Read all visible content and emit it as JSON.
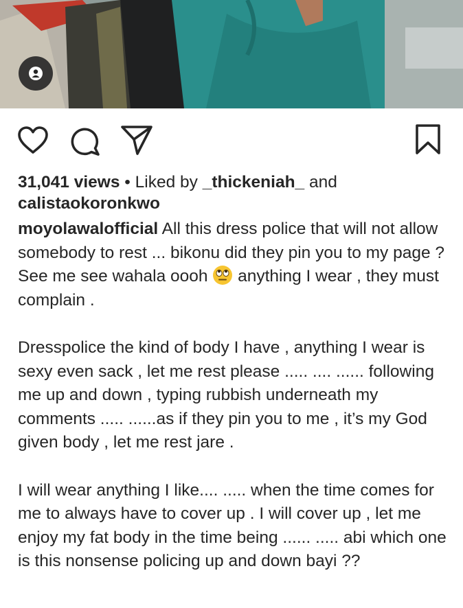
{
  "media": {
    "tag_icon": "user-tag-icon"
  },
  "actions": {
    "like_icon": "heart-icon",
    "comment_icon": "comment-icon",
    "share_icon": "paper-plane-icon",
    "save_icon": "bookmark-icon"
  },
  "stats": {
    "views": "31,041 views",
    "separator": " • Liked by ",
    "liked_by_1": "_thickeniah_",
    "and": " and",
    "liked_by_2": "calistaokoronkwo"
  },
  "caption": {
    "username": "moyolawalofficial",
    "para1_a": " All this dress police that will not allow somebody to rest ... bikonu did they pin you to my page ? See me see wahala oooh ",
    "emoji": "face-with-rolling-eyes-emoji",
    "para1_b": " anything I wear , they must complain .",
    "para2": "Dresspolice the kind of body I have , anything I wear is sexy even sack , let me rest please ..... .... ...... following me up and down , typing rubbish underneath my comments ..... ......as if they pin you to me , it’s my God given body , let me rest jare .",
    "para3": "I will wear anything I like.... ..... when the time comes for me to always have to cover up . I will cover up , let me enjoy my fat body in the time being ...... ..... abi which one is this nonsense policing up and down bayi ??"
  },
  "colors": {
    "text": "#262626",
    "dress_teal": "#2a8f8c",
    "tag_bg": "#262626"
  }
}
